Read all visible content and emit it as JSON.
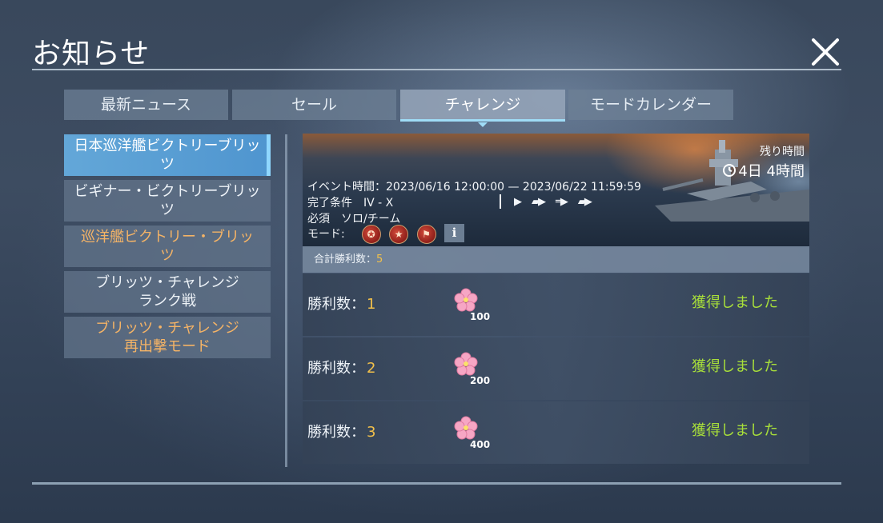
{
  "header": {
    "title": "お知らせ"
  },
  "tabs": [
    {
      "label": "最新ニュース",
      "active": false
    },
    {
      "label": "セール",
      "active": false
    },
    {
      "label": "チャレンジ",
      "active": true
    },
    {
      "label": "モードカレンダー",
      "active": false
    }
  ],
  "sidebar": {
    "items": [
      {
        "lines": [
          "日本巡洋艦ビクトリーブリッ",
          "ツ"
        ],
        "state": "active"
      },
      {
        "lines": [
          "ビギナー・ビクトリーブリッ",
          "ツ"
        ],
        "state": "white"
      },
      {
        "lines": [
          "巡洋艦ビクトリー・ブリッ",
          "ツ"
        ],
        "state": "orange"
      },
      {
        "lines": [
          "ブリッツ・チャレンジ",
          "ランク戦"
        ],
        "state": "white"
      },
      {
        "lines": [
          "ブリッツ・チャレンジ",
          "再出撃モード"
        ],
        "state": "orange"
      }
    ]
  },
  "banner": {
    "remaining_label": "残り時間",
    "remaining_value": "4日 4時間",
    "event_time": "イベント時間：2023/06/16  12:00:00  —  2023/06/22  11:59:59",
    "condition": "完了条件　IV - X",
    "required": "必須　ソロ/チーム",
    "mode_label": "モード:",
    "info_label": "i"
  },
  "total": {
    "label": "合計勝利数：",
    "value": "5"
  },
  "rewards": [
    {
      "label": "勝利数：",
      "wins": "1",
      "amount": "100",
      "status": "獲得しました"
    },
    {
      "label": "勝利数：",
      "wins": "2",
      "amount": "200",
      "status": "獲得しました"
    },
    {
      "label": "勝利数：",
      "wins": "3",
      "amount": "400",
      "status": "獲得しました"
    }
  ],
  "colors": {
    "accent": "#9fdcf6",
    "obtained": "#a8df3a",
    "highlight": "#f2c04a",
    "orange_text": "#f4b366"
  }
}
